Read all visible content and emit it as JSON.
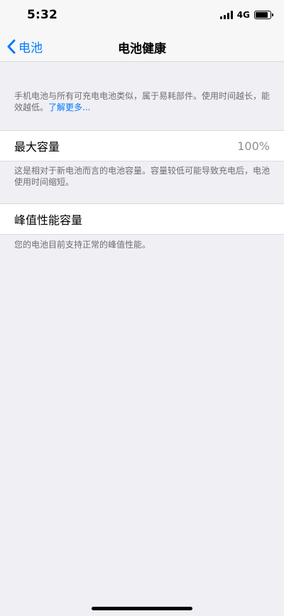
{
  "status_bar": {
    "time": "5:32",
    "network": "4G",
    "battery_level": 0.85
  },
  "nav": {
    "back_label": "电池",
    "title": "电池健康"
  },
  "intro": {
    "text": "手机电池与所有可充电电池类似，属于易耗部件。使用时间越长，能效越低。",
    "learn_more": "了解更多..."
  },
  "max_capacity": {
    "label": "最大容量",
    "value": "100%",
    "footnote": "这是相对于新电池而言的电池容量。容量较低可能导致充电后，电池使用时间缩短。"
  },
  "peak_performance": {
    "label": "峰值性能容量",
    "footnote": "您的电池目前支持正常的峰值性能。"
  },
  "colors": {
    "accent": "#007aff",
    "background": "#efeff4",
    "secondary_text": "#6d6d72"
  }
}
